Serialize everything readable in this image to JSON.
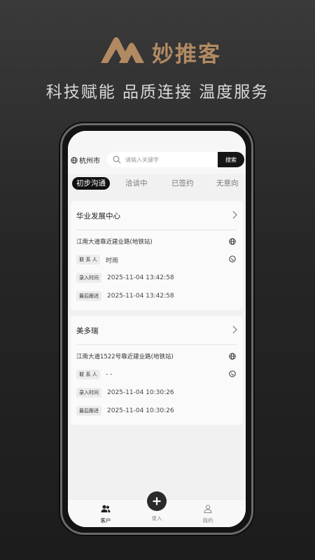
{
  "brand": {
    "name": "妙推客",
    "slogan": "科技赋能 品质连接 温度服务"
  },
  "search": {
    "city": "杭州市",
    "placeholder": "请输入关键字",
    "button": "搜索"
  },
  "tabs": [
    {
      "label": "初步沟通",
      "active": true
    },
    {
      "label": "洽谈中",
      "active": false
    },
    {
      "label": "已签约",
      "active": false
    },
    {
      "label": "无意向",
      "active": false
    }
  ],
  "cards": [
    {
      "title": "华业发展中心",
      "address": "江南大道靠近建业路(地铁站)",
      "contact_label": "联 系 人",
      "contact": "时雨",
      "entry_label": "录入时间",
      "entry_time": "2025-11-04 13:42:58",
      "follow_label": "最后跟进",
      "follow_time": "2025-11-04 13:42:58"
    },
    {
      "title": "美多瑞",
      "address": "江南大道1522号靠近建业路(地铁站)",
      "contact_label": "联 系 人",
      "contact": "- -",
      "entry_label": "录入时间",
      "entry_time": "2025-11-04 10:30:26",
      "follow_label": "最后跟进",
      "follow_time": "2025-11-04 10:30:26"
    }
  ],
  "nav": {
    "customers": "客户",
    "add": "录入",
    "mine": "我的"
  },
  "colors": {
    "brand": "#b28a62",
    "dark": "#151515"
  }
}
